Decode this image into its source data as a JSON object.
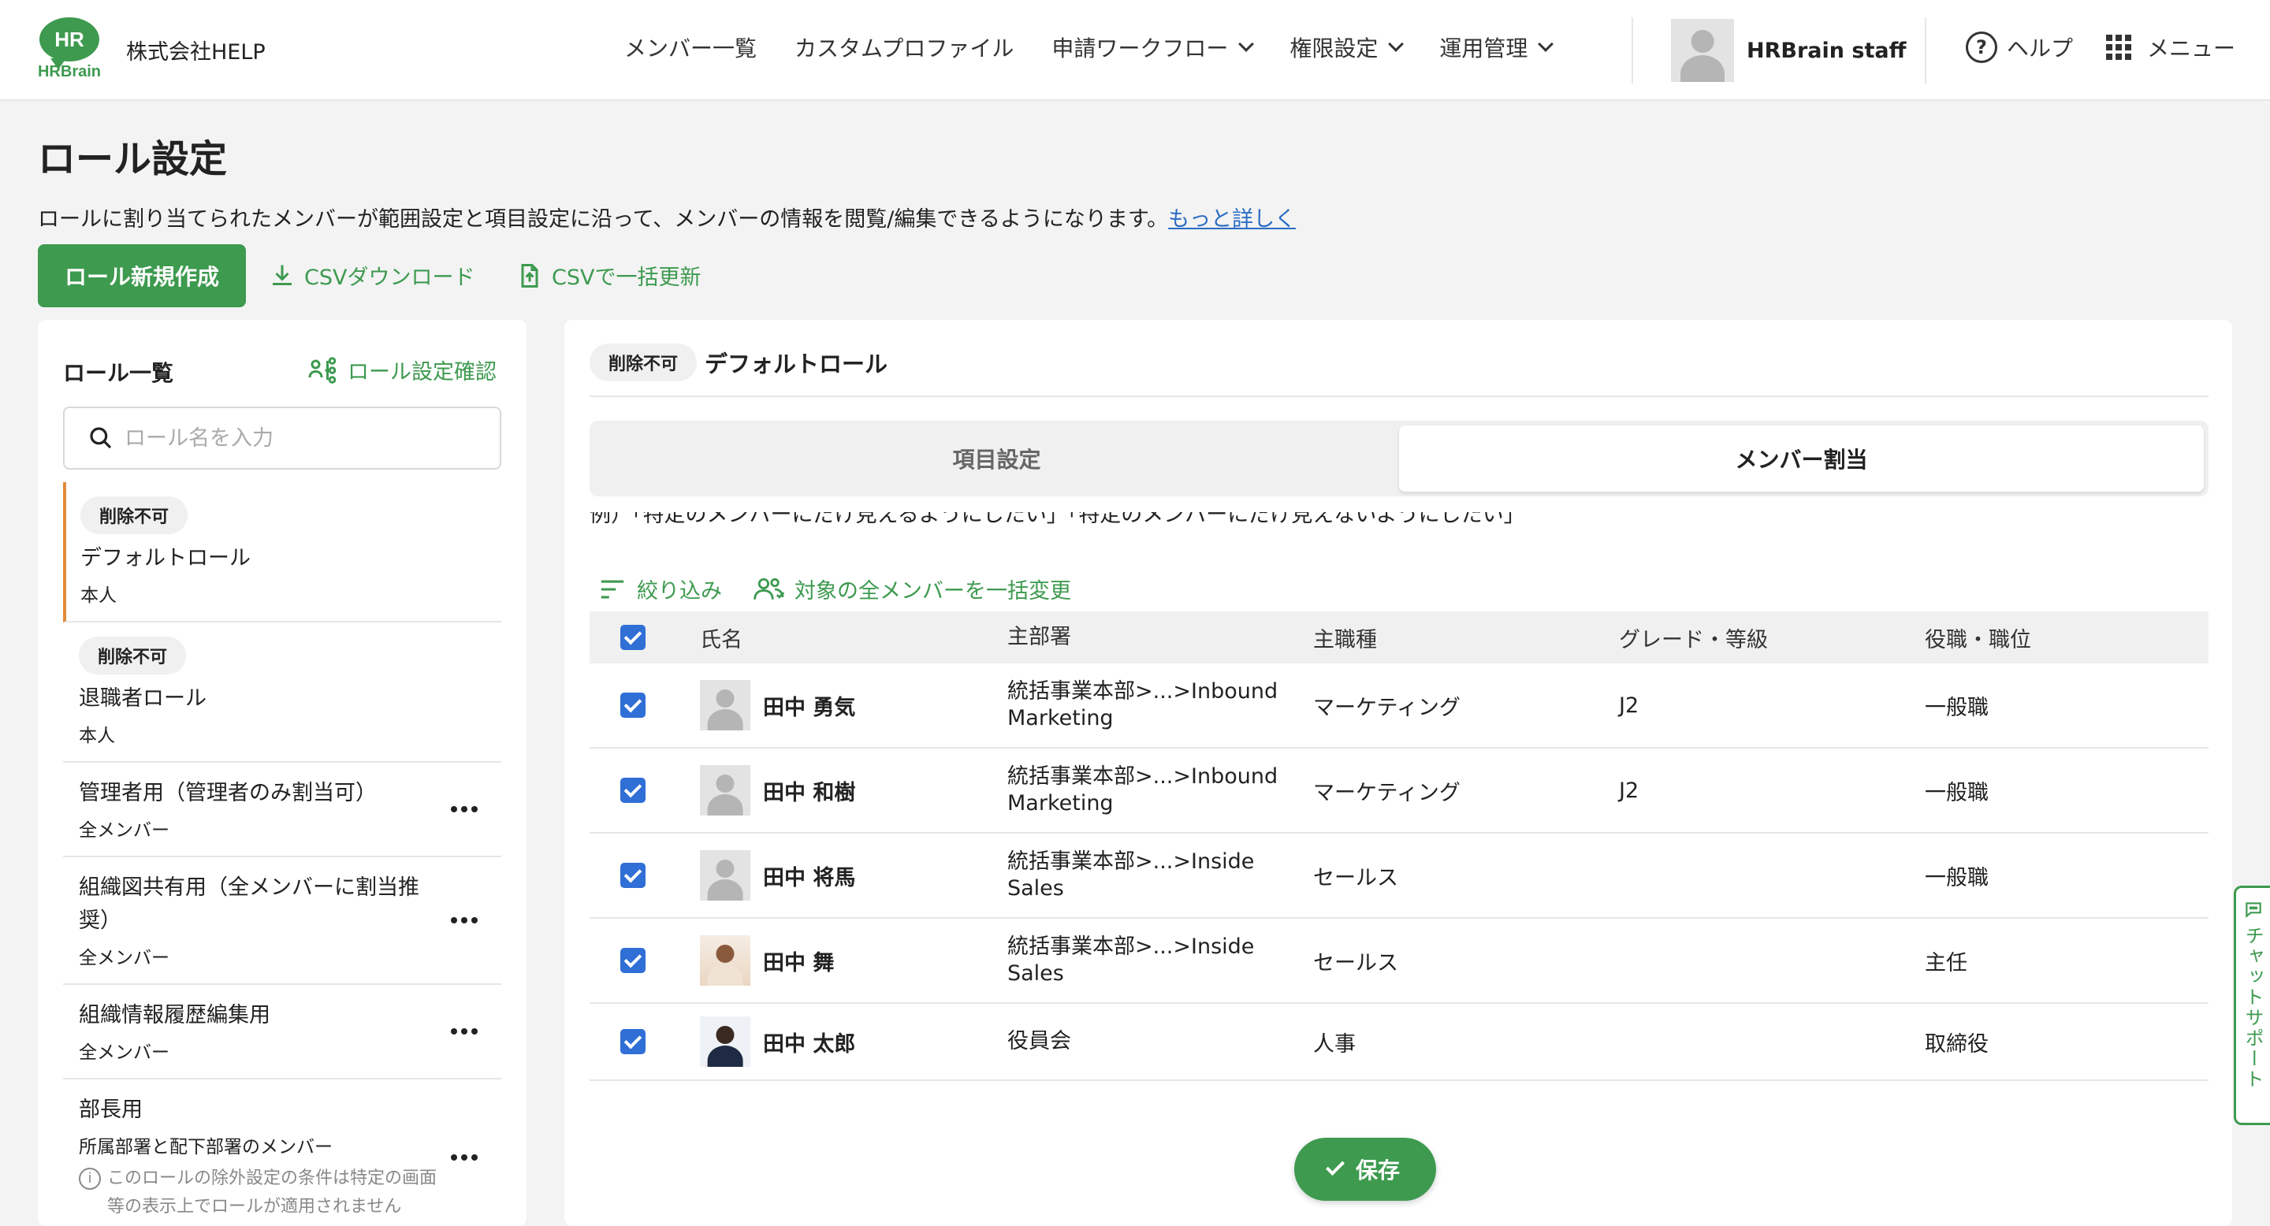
{
  "header": {
    "logo_text": "HR",
    "logo_brand": "HRBrain",
    "company": "株式会社HELP",
    "nav": [
      {
        "label": "メンバー一覧"
      },
      {
        "label": "カスタムプロファイル"
      },
      {
        "label": "申請ワークフロー"
      },
      {
        "label": "権限設定"
      },
      {
        "label": "運用管理"
      }
    ],
    "user_name": "HRBrain staff",
    "help_label": "ヘルプ",
    "menu_label": "メニュー"
  },
  "page": {
    "title": "ロール設定",
    "description": "ロールに割り当てられたメンバーが範囲設定と項目設定に沿って、メンバーの情報を閲覧/編集できるようになります。",
    "more_link": "もっと詳しく",
    "new_role_button": "ロール新規作成",
    "csv_download": "CSVダウンロード",
    "csv_update": "CSVで一括更新"
  },
  "role_panel": {
    "title": "ロール一覧",
    "check_link": "ロール設定確認",
    "search_placeholder": "ロール名を入力",
    "roles": [
      {
        "badge": "削除不可",
        "name": "デフォルトロール",
        "scope": "本人"
      },
      {
        "badge": "削除不可",
        "name": "退職者ロール",
        "scope": "本人"
      },
      {
        "name": "管理者用（管理者のみ割当可）",
        "scope": "全メンバー"
      },
      {
        "name": "組織図共有用（全メンバーに割当推奨）",
        "scope": "全メンバー"
      },
      {
        "name": "組織情報履歴編集用",
        "scope": "全メンバー"
      },
      {
        "name": "部長用",
        "scope": "所属部署と配下部署のメンバー",
        "note": "このロールの除外設定の条件は特定の画面等の表示上でロールが適用されません"
      }
    ]
  },
  "detail": {
    "badge": "削除不可",
    "role_name": "デフォルトロール",
    "tabs": [
      {
        "label": "項目設定"
      },
      {
        "label": "メンバー割当"
      }
    ],
    "cut_text": "例）「特定のメンバーにだけ見えるようにしたい」「特定のメンバーにだけ見えないようにしたい」",
    "filter_label": "絞り込み",
    "bulk_change_label": "対象の全メンバーを一括変更",
    "columns": {
      "name": "氏名",
      "dept": "主部署",
      "job": "主職種",
      "grade": "グレード・等級",
      "position": "役職・職位"
    },
    "members": [
      {
        "name": "田中 勇気",
        "dept": "統括事業本部>...>Inbound Marketing",
        "job": "マーケティング",
        "grade": "J2",
        "position": "一般職"
      },
      {
        "name": "田中 和樹",
        "dept": "統括事業本部>...>Inbound Marketing",
        "job": "マーケティング",
        "grade": "J2",
        "position": "一般職"
      },
      {
        "name": "田中 将馬",
        "dept": "統括事業本部>...>Inside Sales",
        "job": "セールス",
        "grade": "",
        "position": "一般職"
      },
      {
        "name": "田中 舞",
        "dept": "統括事業本部>...>Inside Sales",
        "job": "セールス",
        "grade": "",
        "position": "主任"
      },
      {
        "name": "田中 太郎",
        "dept": "役員会",
        "job": "人事",
        "grade": "",
        "position": "取締役"
      }
    ],
    "save_label": "保存"
  },
  "chat_support": "チャットサポート",
  "colors": {
    "brand_green": "#3d9a4f",
    "checkbox_blue": "#2f6fd6",
    "active_accent": "#e08a3a",
    "link_blue": "#2b6cc4"
  }
}
